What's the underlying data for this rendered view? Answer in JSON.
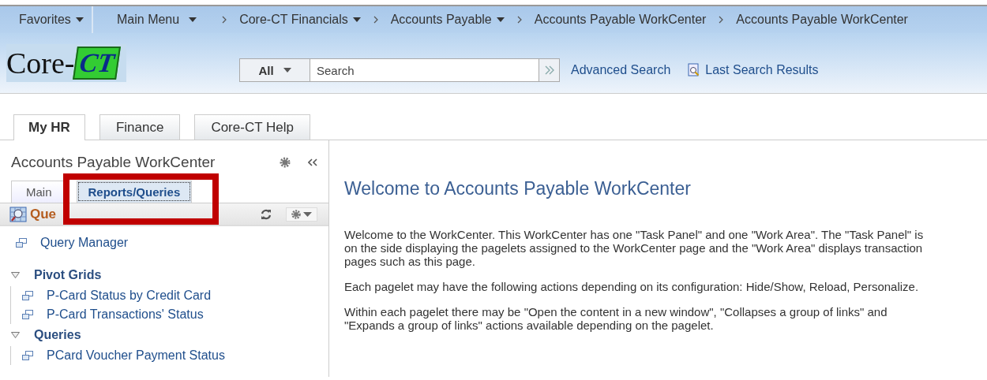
{
  "nav": {
    "favorites": {
      "label": "Favorites",
      "dropdown": true
    },
    "breadcrumbs": [
      {
        "label": "Main Menu",
        "dropdown": true
      },
      {
        "label": "Core-CT Financials",
        "dropdown": true
      },
      {
        "label": "Accounts Payable",
        "dropdown": true
      },
      {
        "label": "Accounts Payable WorkCenter",
        "dropdown": false
      },
      {
        "label": "Accounts Payable WorkCenter",
        "dropdown": false
      }
    ]
  },
  "header": {
    "logo": {
      "text": "Core-",
      "mark": "CT"
    },
    "search": {
      "scope": "All",
      "placeholder": "Search"
    },
    "links": [
      {
        "label": "Advanced Search",
        "icon": false
      },
      {
        "label": "Last Search Results",
        "icon": true
      }
    ]
  },
  "tabs": [
    {
      "label": "My HR",
      "selected": true
    },
    {
      "label": "Finance",
      "selected": false
    },
    {
      "label": "Core-CT Help",
      "selected": false
    }
  ],
  "task_panel": {
    "title": "Accounts Payable WorkCenter",
    "subtabs": [
      {
        "label": "Main",
        "selected": false
      },
      {
        "label": "Reports/Queries",
        "selected": true
      }
    ],
    "pagelet": {
      "title": "Que",
      "items": [
        {
          "kind": "link",
          "label": "Query Manager"
        },
        {
          "kind": "group",
          "label": "Pivot Grids",
          "expanded": true,
          "children": [
            {
              "kind": "link",
              "label": "P-Card Status by Credit Card"
            },
            {
              "kind": "link",
              "label": "P-Card Transactions' Status"
            }
          ]
        },
        {
          "kind": "group",
          "label": "Queries",
          "expanded": true,
          "children": [
            {
              "kind": "link",
              "label": "PCard Voucher Payment Status"
            }
          ]
        }
      ]
    }
  },
  "work_area": {
    "heading": "Welcome to Accounts Payable WorkCenter",
    "paragraphs": [
      "Welcome to the WorkCenter. This WorkCenter has one \"Task Panel\" and one \"Work Area\". The \"Task Panel\" is on the side displaying the pagelets assigned to the WorkCenter page and the \"Work Area\" displays transaction pages such as this page.",
      "Each pagelet may have the following actions depending on its configuration: Hide/Show, Reload, Personalize.",
      "Within each pagelet there may be \"Open the content in a new window\", \"Collapses a group of links\" and \"Expands a group of links\" actions available depending on the pagelet."
    ]
  }
}
